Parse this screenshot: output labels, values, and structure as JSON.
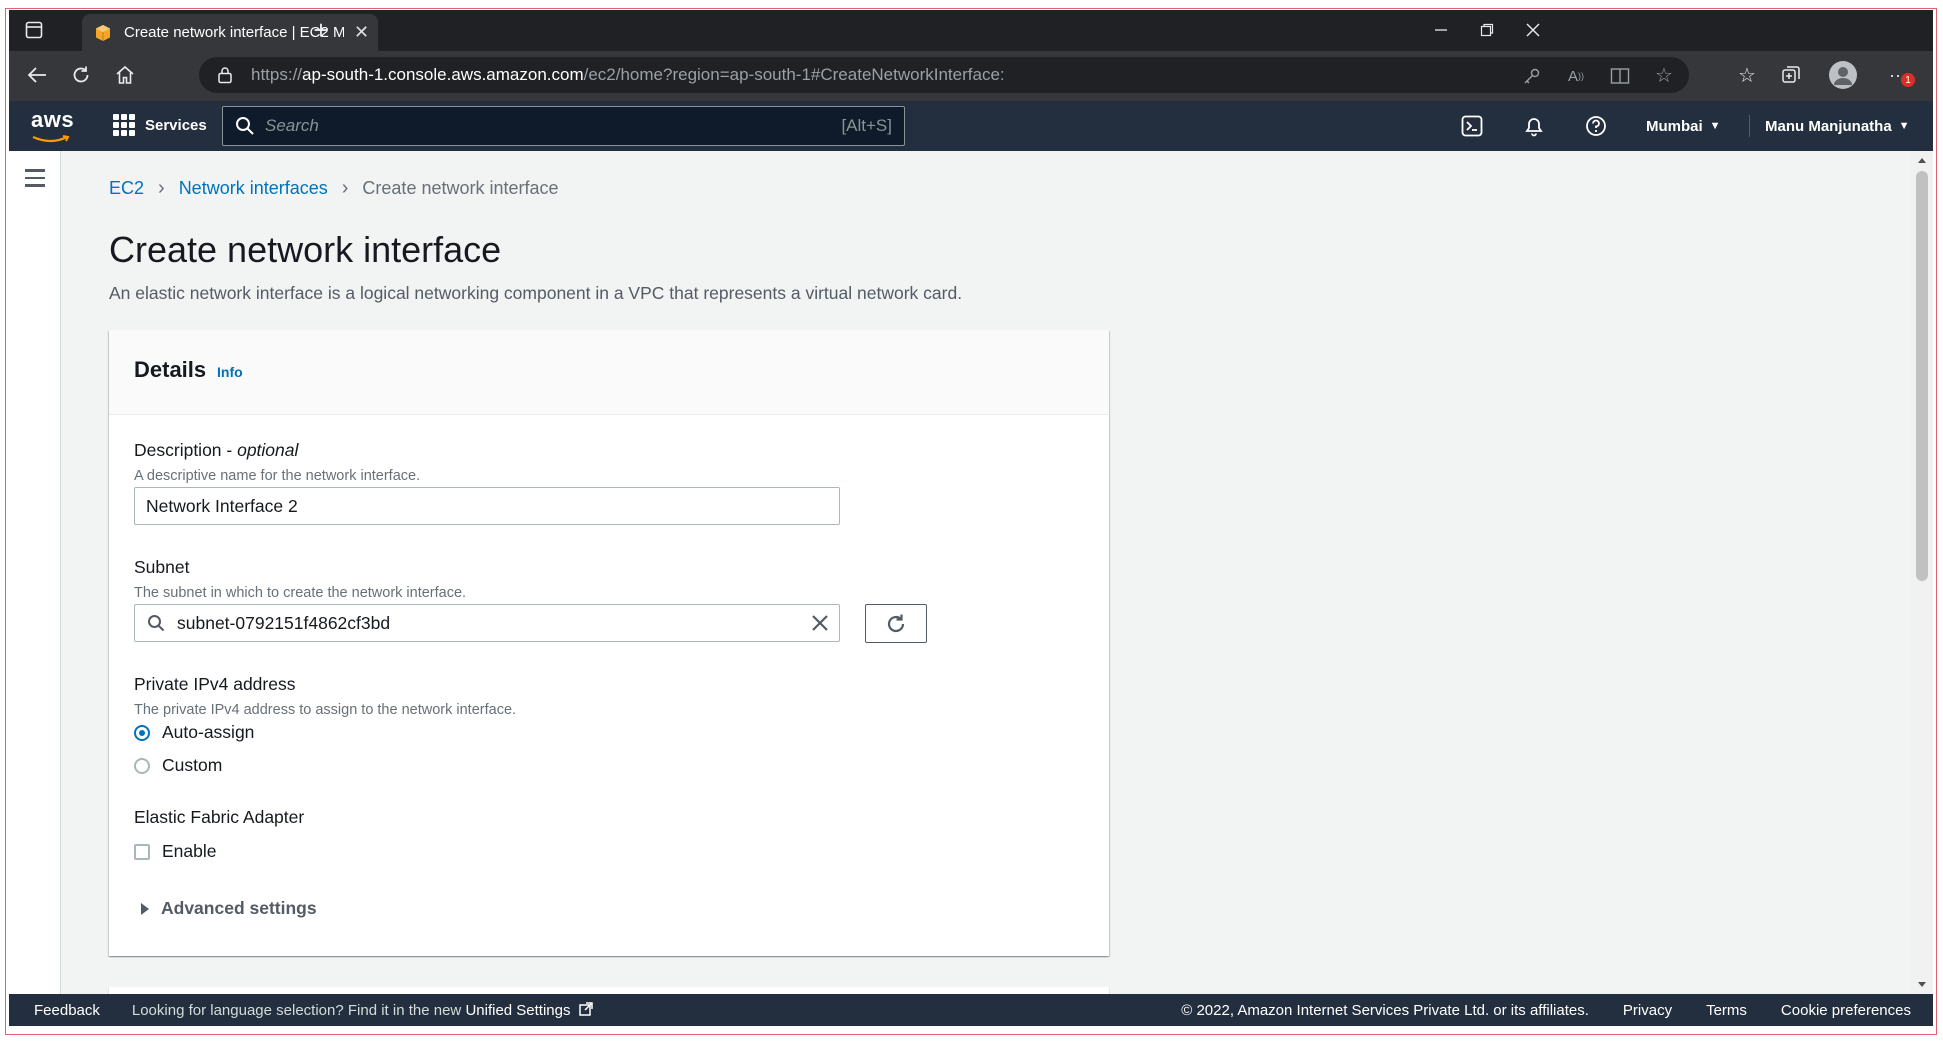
{
  "browser": {
    "tab_title": "Create network interface | EC2 M",
    "url_prefix": "https://",
    "url_host": "ap-south-1.console.aws.amazon.com",
    "url_path": "/ec2/home?region=ap-south-1#CreateNetworkInterface:",
    "notification_count": "1"
  },
  "awsnav": {
    "logo": "aws",
    "services_label": "Services",
    "search_placeholder": "Search",
    "search_shortcut": "[Alt+S]",
    "region": "Mumbai",
    "user": "Manu Manjunatha"
  },
  "breadcrumb": {
    "items": [
      "EC2",
      "Network interfaces",
      "Create network interface"
    ]
  },
  "page": {
    "title": "Create network interface",
    "description": "An elastic network interface is a logical networking component in a VPC that represents a virtual network card."
  },
  "details": {
    "heading": "Details",
    "info_link": "Info",
    "description_label": "Description - ",
    "description_optional": "optional",
    "description_hint": "A descriptive name for the network interface.",
    "description_value": "Network Interface 2",
    "subnet_label": "Subnet",
    "subnet_hint": "The subnet in which to create the network interface.",
    "subnet_value": "subnet-0792151f4862cf3bd",
    "ipv4_label": "Private IPv4 address",
    "ipv4_hint": "The private IPv4 address to assign to the network interface.",
    "ipv4_options": [
      {
        "label": "Auto-assign",
        "selected": true
      },
      {
        "label": "Custom",
        "selected": false
      }
    ],
    "efa_label": "Elastic Fabric Adapter",
    "efa_option": "Enable",
    "efa_checked": false,
    "advanced_label": "Advanced settings"
  },
  "footer": {
    "feedback": "Feedback",
    "lang_text": "Looking for language selection? Find it in the new ",
    "lang_link": "Unified Settings",
    "copyright": "© 2022, Amazon Internet Services Private Ltd. or its affiliates.",
    "privacy": "Privacy",
    "terms": "Terms",
    "cookies": "Cookie preferences"
  },
  "colors": {
    "aws_nav": "#232f3e",
    "link": "#0073bb",
    "console_bg": "#f2f3f3"
  }
}
